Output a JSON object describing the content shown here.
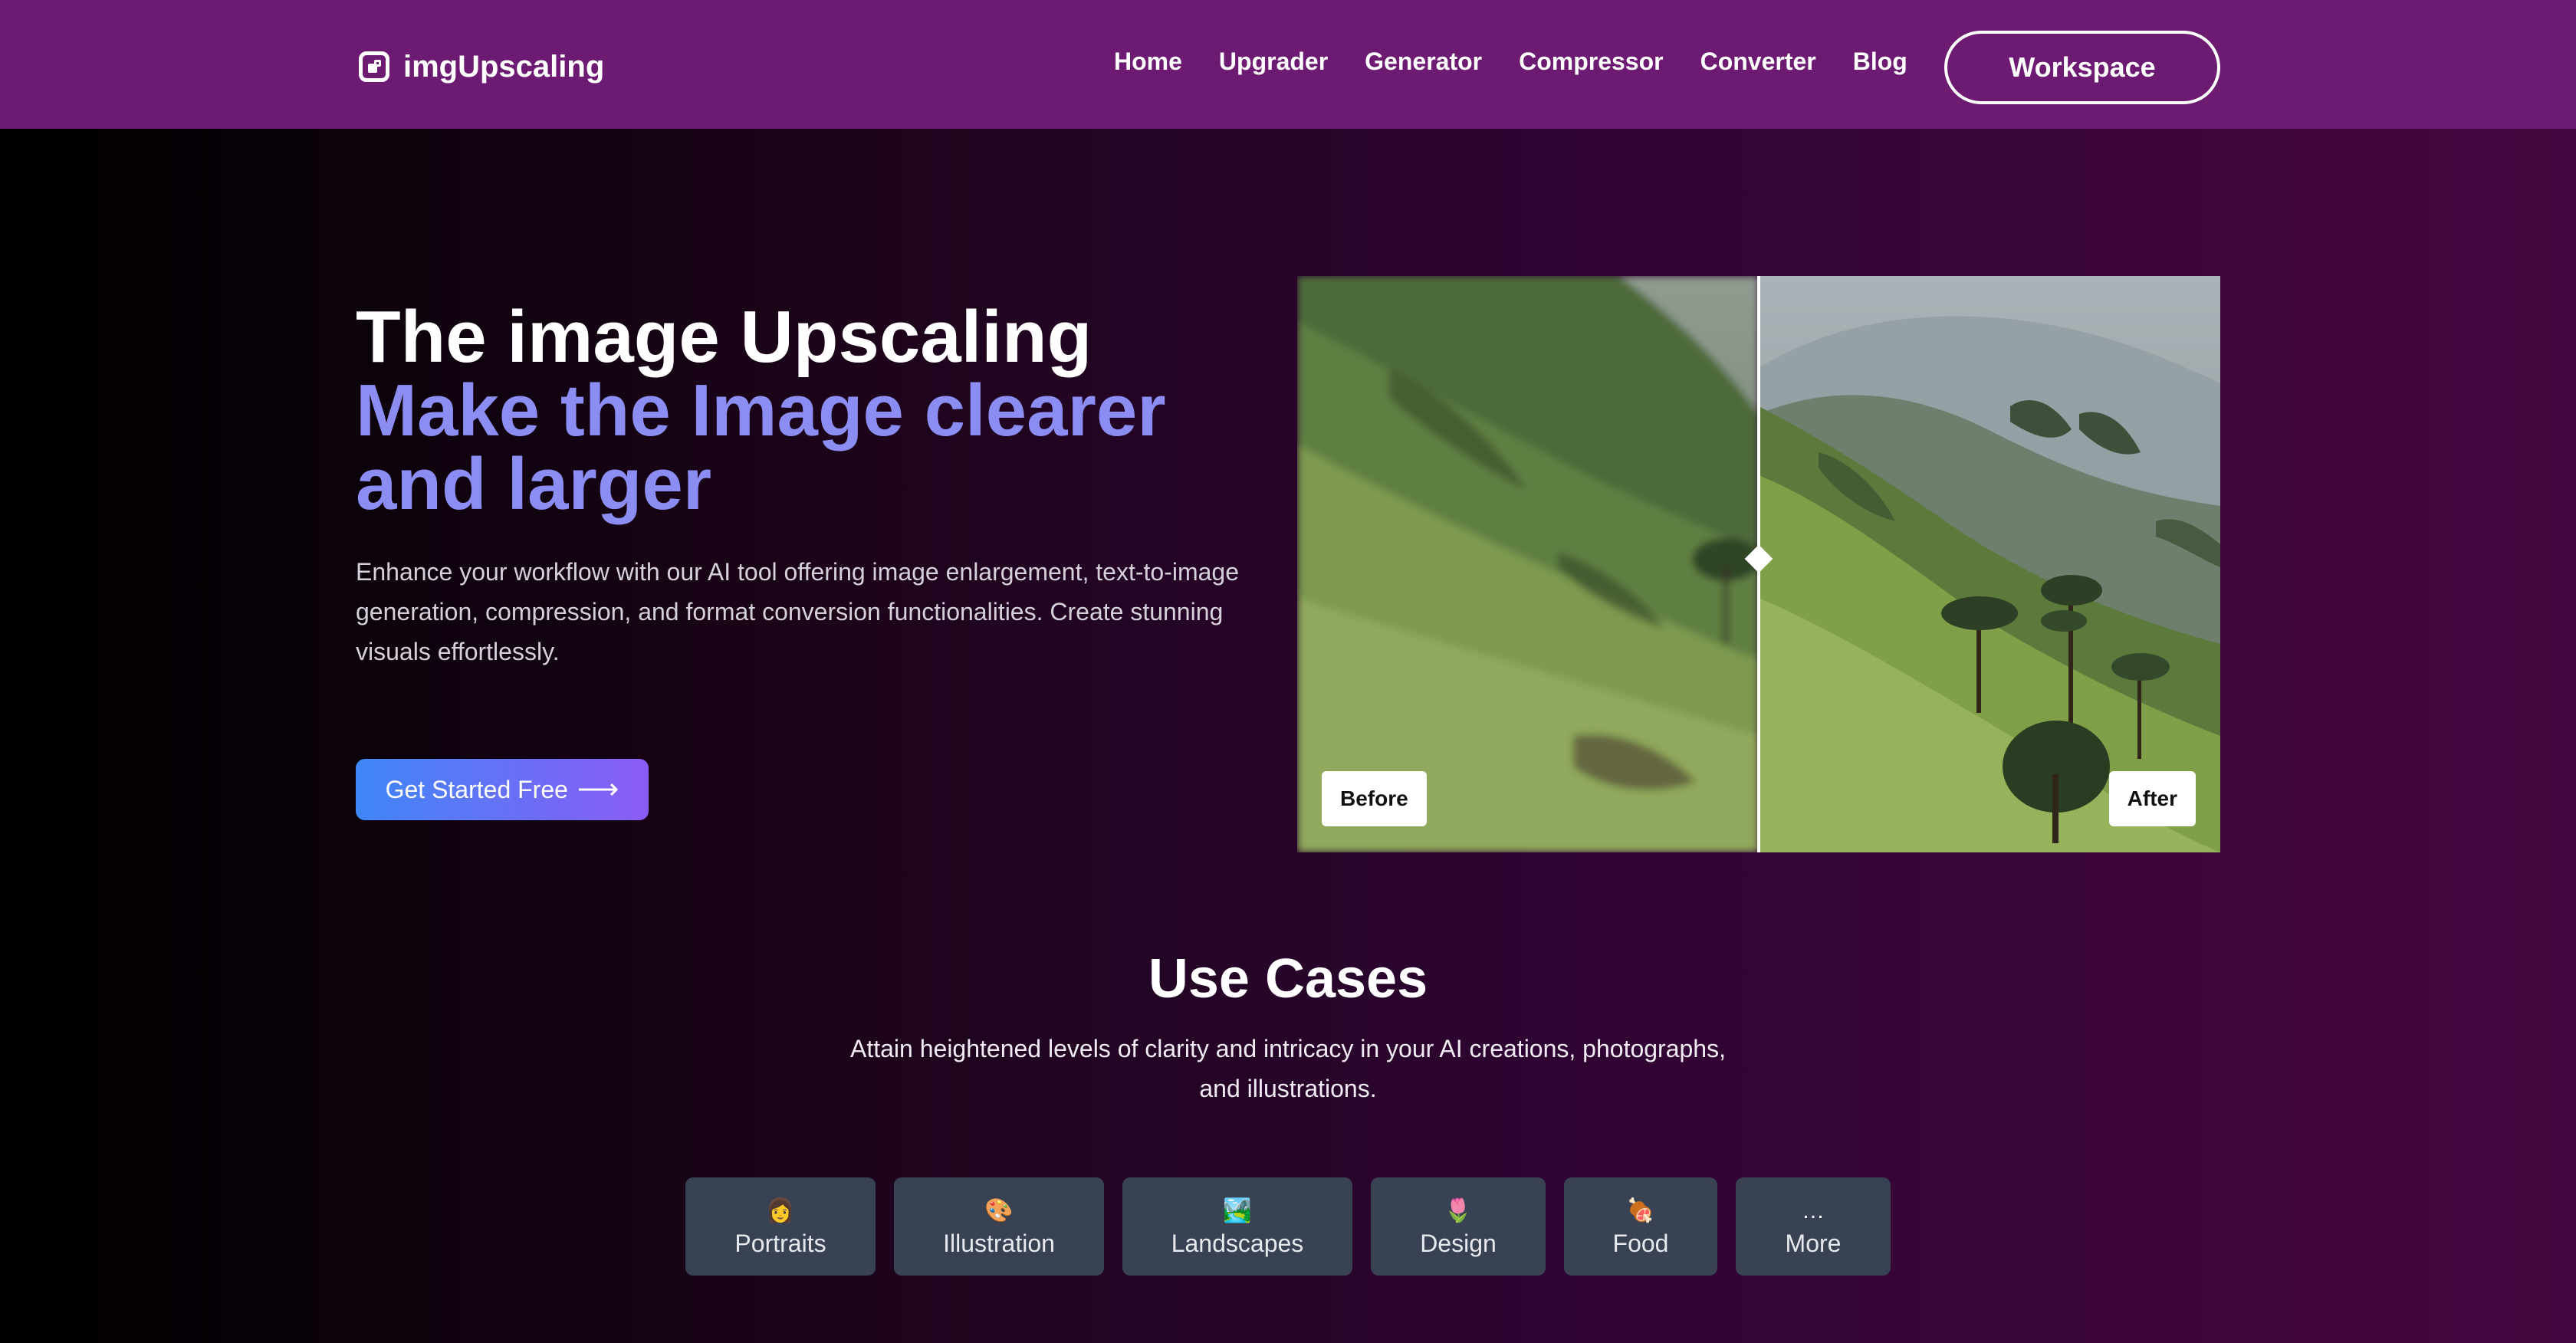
{
  "brand": {
    "name": "imgUpscaling",
    "icon": "upscale-logo-icon"
  },
  "nav": {
    "links": [
      "Home",
      "Upgrader",
      "Generator",
      "Compressor",
      "Converter",
      "Blog"
    ],
    "workspace_label": "Workspace"
  },
  "hero": {
    "title_line1": "The image Upscaling",
    "title_line2": "Make the Image clearer and larger",
    "description": "Enhance your workflow with our AI tool offering image enlargement, text-to-image generation, compression, and format conversion functionalities. Create stunning visuals effortlessly.",
    "cta_label": "Get Started Free",
    "cta_arrow": "⟶"
  },
  "comparison": {
    "before_label": "Before",
    "after_label": "After"
  },
  "use_cases": {
    "title": "Use Cases",
    "description": "Attain heightened levels of clarity and intricacy in your AI creations, photographs, and illustrations.",
    "chips": [
      {
        "icon": "👩",
        "label": "Portraits"
      },
      {
        "icon": "🎨",
        "label": "Illustration"
      },
      {
        "icon": "🏞️",
        "label": "Landscapes"
      },
      {
        "icon": "🌷",
        "label": "Design"
      },
      {
        "icon": "🍖",
        "label": "Food"
      },
      {
        "icon": "…",
        "label": "More"
      }
    ]
  },
  "colors": {
    "nav_bg": "#6d1b72",
    "accent_text": "#8b8df2",
    "cta_gradient_start": "#3f86f7",
    "cta_gradient_end": "#8b5cf6",
    "chip_bg": "#384253"
  }
}
